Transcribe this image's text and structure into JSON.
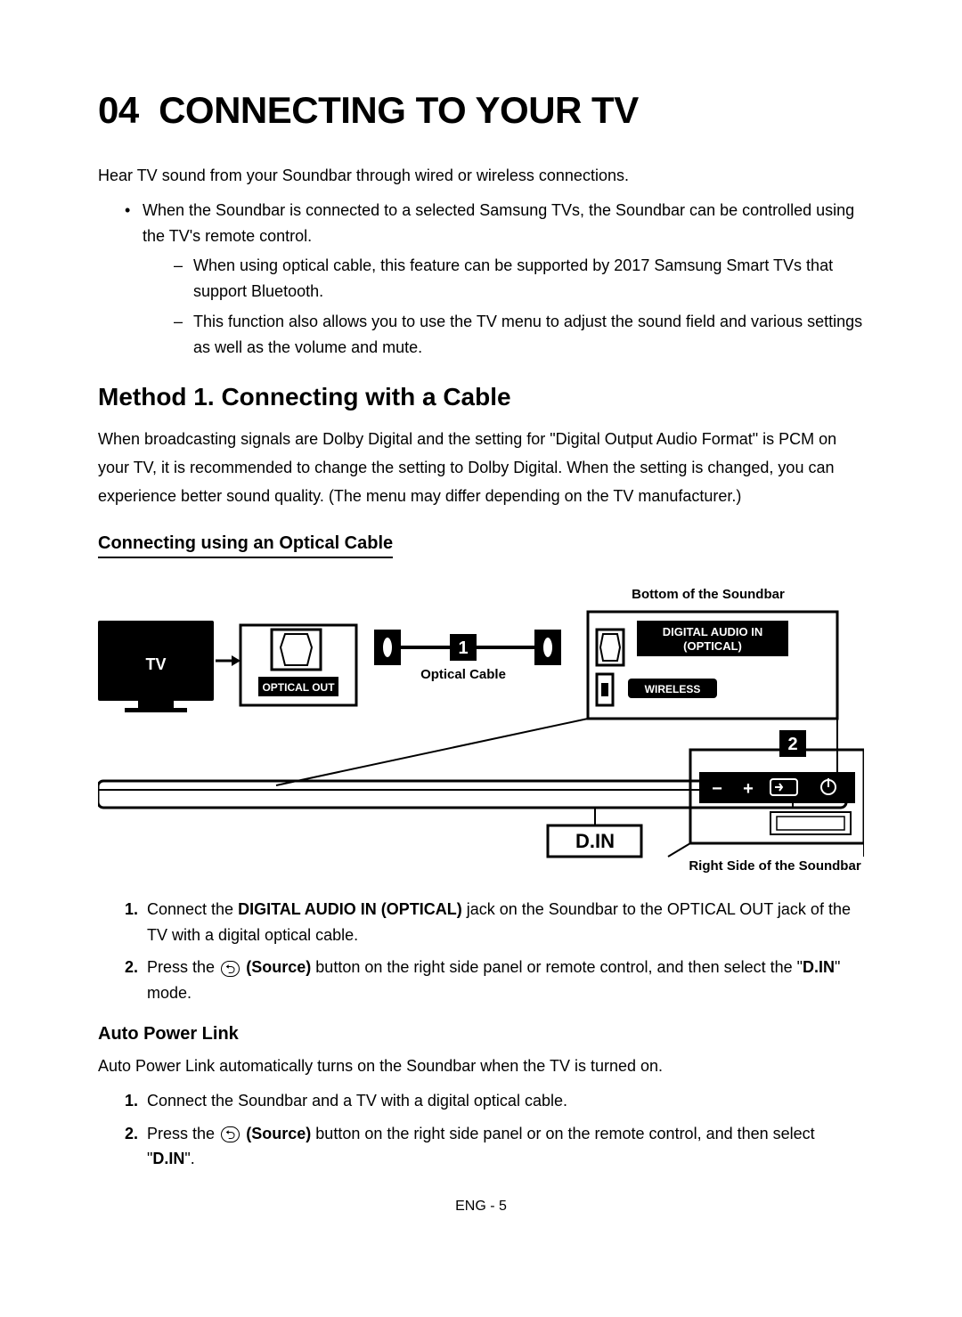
{
  "chapter": {
    "number": "04",
    "title": "CONNECTING TO YOUR TV"
  },
  "intro": "Hear TV sound from your Soundbar through wired or wireless connections.",
  "bullet1": "When the Soundbar is connected to a selected Samsung TVs, the Soundbar can be controlled using the TV's remote control.",
  "dash1": "When using optical cable, this feature can be supported by 2017 Samsung Smart TVs that support Bluetooth.",
  "dash2": "This function also allows you to use the TV menu to adjust the sound field and various settings as well as the volume and mute.",
  "method1": {
    "heading": "Method 1. Connecting with a Cable",
    "desc": "When broadcasting signals are Dolby Digital and the setting for \"Digital Output Audio Format\" is PCM on your TV, it is recommended to change the setting to Dolby Digital. When the setting is changed, you can experience better sound quality. (The menu may differ depending on the TV manufacturer.)"
  },
  "optical": {
    "heading": "Connecting using an Optical Cable",
    "label_bottom": "Bottom of the Soundbar",
    "label_tv": "TV",
    "label_optical_out": "OPTICAL OUT",
    "label_optical_cable": "Optical Cable",
    "label_digital_audio_in": "DIGITAL AUDIO IN",
    "label_optical_paren": "(OPTICAL)",
    "label_wireless": "WIRELESS",
    "label_din": "D.IN",
    "label_right_side": "Right Side of the Soundbar"
  },
  "steps1": {
    "s1_pre": "Connect the ",
    "s1_bold": "DIGITAL AUDIO IN (OPTICAL)",
    "s1_post": " jack on the Soundbar to the OPTICAL OUT jack of the TV with a digital optical cable.",
    "s2_pre": "Press the ",
    "s2_source": "(Source)",
    "s2_mid": " button on the right side panel or remote control, and then select the \"",
    "s2_din": "D.IN",
    "s2_post": "\" mode."
  },
  "autopower": {
    "heading": "Auto Power Link",
    "desc": "Auto Power Link automatically turns on the Soundbar when the TV is turned on.",
    "s1": "Connect the Soundbar and a TV with a digital optical cable.",
    "s2_pre": "Press the ",
    "s2_source": "(Source)",
    "s2_mid": " button on the right side panel or on the remote control, and then select \"",
    "s2_din": "D.IN",
    "s2_post": "\"."
  },
  "footer": "ENG - 5"
}
